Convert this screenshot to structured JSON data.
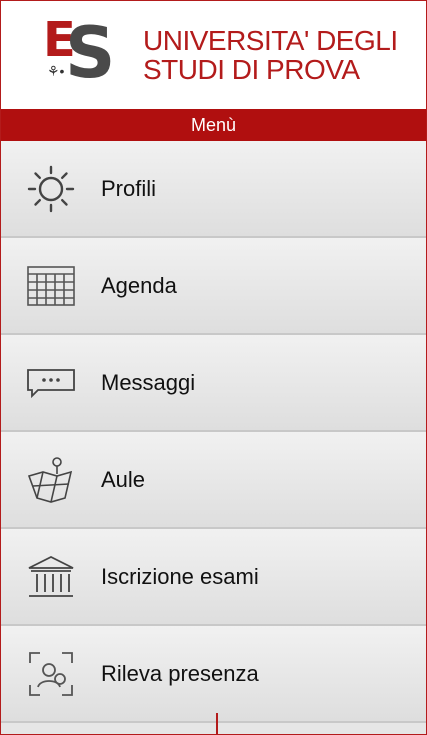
{
  "header": {
    "logo_letters": "ES",
    "logo_e": "E",
    "logo_s": "S",
    "university_line1": "UNIVERSITA' DEGLI",
    "university_line2": "STUDI DI PROVA"
  },
  "menu_title": "Menù",
  "menu": {
    "items": [
      {
        "label": "Profili",
        "icon": "gear-icon"
      },
      {
        "label": "Agenda",
        "icon": "calendar-icon"
      },
      {
        "label": "Messaggi",
        "icon": "chat-bubble-icon"
      },
      {
        "label": "Aule",
        "icon": "map-pin-icon"
      },
      {
        "label": "Iscrizione esami",
        "icon": "institution-icon"
      },
      {
        "label": "Rileva presenza",
        "icon": "scan-person-icon"
      }
    ]
  },
  "colors": {
    "accent": "#b31b1b",
    "menu_bar": "#b00f0f",
    "item_bg": "#e6e6e6"
  }
}
